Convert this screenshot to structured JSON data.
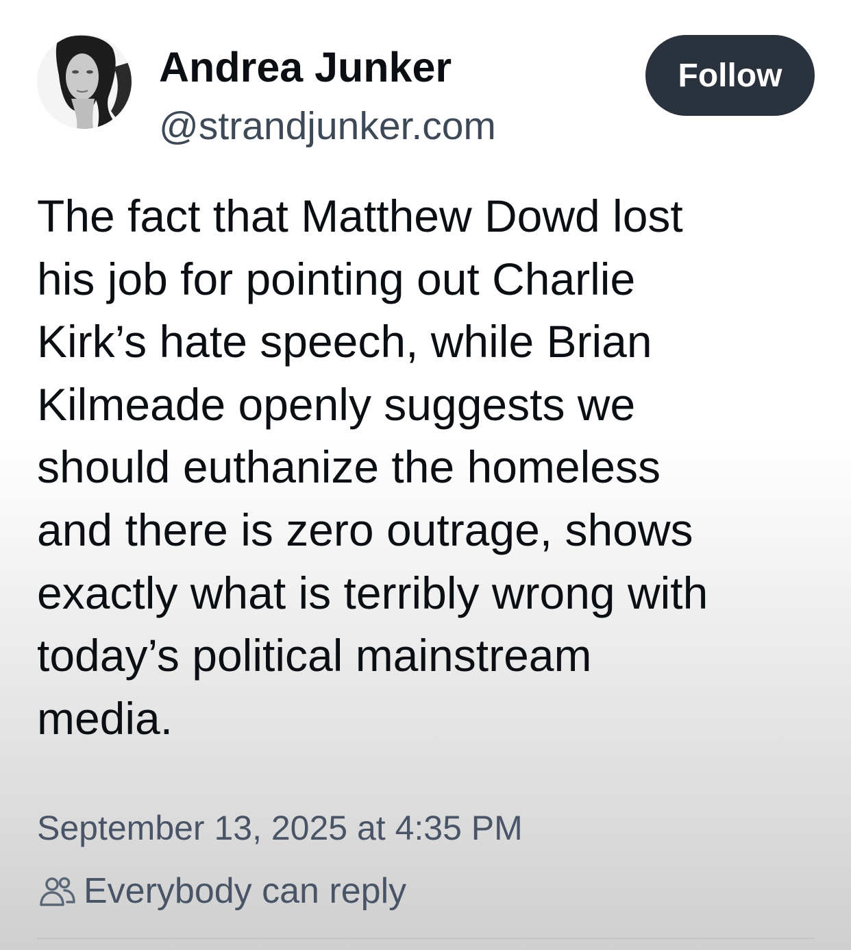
{
  "author": {
    "display_name": "Andrea Junker",
    "handle": "@strandjunker.com"
  },
  "follow_button": {
    "label": "Follow"
  },
  "post": {
    "text_lines": [
      "The fact that Matthew Dowd lost",
      "his job for pointing out Charlie",
      "Kirk’s hate speech, while Brian",
      "Kilmeade openly suggests we",
      "should euthanize the homeless",
      "and there is zero outrage, shows",
      "exactly what is terribly wrong with",
      "today’s political mainstream",
      "media."
    ],
    "timestamp": "September 13, 2025 at 4:35 PM",
    "reply_setting": "Everybody can reply"
  },
  "icons": {
    "avatar": "profile-photo",
    "reply_setting": "people-icon"
  },
  "colors": {
    "follow_button_bg": "#2a323d",
    "follow_button_text": "#ffffff",
    "primary_text": "#0b0f14",
    "secondary_text": "#495566"
  }
}
